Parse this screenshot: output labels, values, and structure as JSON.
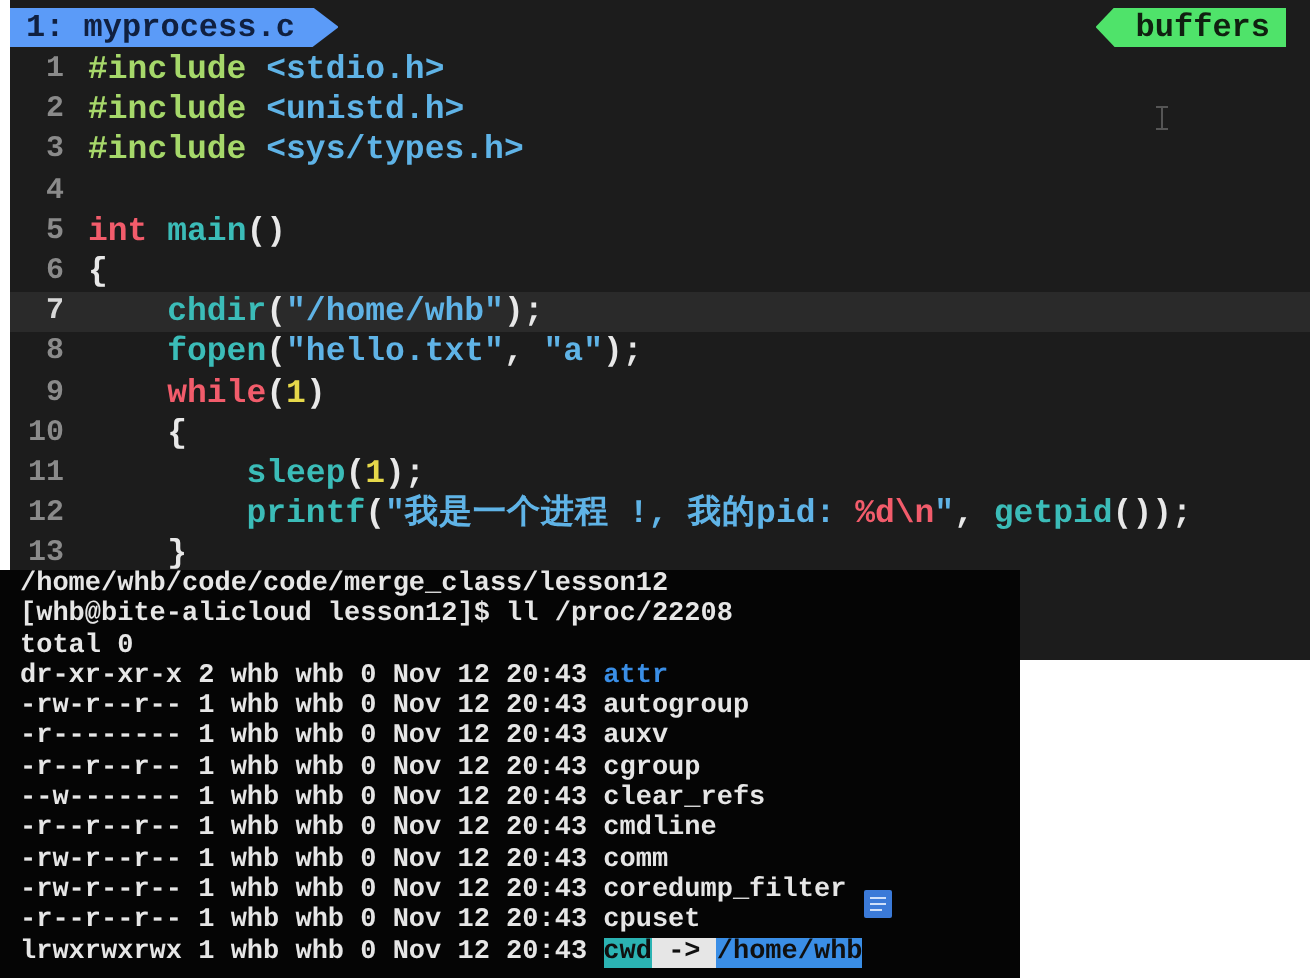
{
  "editor": {
    "tab_label": "1: myprocess.c",
    "buffers_label": "buffers",
    "lines": [
      {
        "number": "1",
        "current": false,
        "tokens": [
          {
            "kind": "pre",
            "text": "#include"
          },
          {
            "kind": "str",
            "text": " <stdio.h>"
          }
        ]
      },
      {
        "number": "2",
        "current": false,
        "tokens": [
          {
            "kind": "pre",
            "text": "#include"
          },
          {
            "kind": "str",
            "text": " <unistd.h>"
          }
        ]
      },
      {
        "number": "3",
        "current": false,
        "tokens": [
          {
            "kind": "pre",
            "text": "#include"
          },
          {
            "kind": "str",
            "text": " <sys/types.h>"
          }
        ]
      },
      {
        "number": "4",
        "current": false
      },
      {
        "number": "5",
        "current": false,
        "tokens": [
          {
            "kind": "kw",
            "text": "int"
          },
          {
            "kind": "fn",
            "text": " main"
          },
          {
            "kind": "plain",
            "text": "()"
          }
        ]
      },
      {
        "number": "6",
        "current": false,
        "tokens": [
          {
            "kind": "plain",
            "text": "{"
          }
        ]
      },
      {
        "number": "7",
        "current": true,
        "tokens": [
          {
            "kind": "fn",
            "text": "    chdir"
          },
          {
            "kind": "plain",
            "text": "("
          },
          {
            "kind": "str",
            "text": "\"/home/whb\""
          },
          {
            "kind": "plain",
            "text": ");"
          }
        ]
      },
      {
        "number": "8",
        "current": false,
        "tokens": [
          {
            "kind": "fn",
            "text": "    fopen"
          },
          {
            "kind": "plain",
            "text": "("
          },
          {
            "kind": "str",
            "text": "\"hello.txt\""
          },
          {
            "kind": "plain",
            "text": ","
          },
          {
            "kind": "str",
            "text": " \"a\""
          },
          {
            "kind": "plain",
            "text": ");"
          }
        ]
      },
      {
        "number": "9",
        "current": false,
        "tokens": [
          {
            "kind": "kw",
            "text": "    while"
          },
          {
            "kind": "plain",
            "text": "("
          },
          {
            "kind": "num",
            "text": "1"
          },
          {
            "kind": "plain",
            "text": ")"
          }
        ]
      },
      {
        "number": "10",
        "current": false,
        "tokens": [
          {
            "kind": "plain",
            "text": "    {"
          }
        ]
      },
      {
        "number": "11",
        "current": false,
        "tokens": [
          {
            "kind": "fn",
            "text": "        sleep"
          },
          {
            "kind": "plain",
            "text": "("
          },
          {
            "kind": "num",
            "text": "1"
          },
          {
            "kind": "plain",
            "text": ");"
          }
        ]
      },
      {
        "number": "12",
        "current": false,
        "tokens": [
          {
            "kind": "fn",
            "text": "        printf"
          },
          {
            "kind": "plain",
            "text": "("
          },
          {
            "kind": "str",
            "text": "\"我是一个进程 !, 我的pid: "
          },
          {
            "kind": "kw",
            "text": "%d\\n"
          },
          {
            "kind": "str",
            "text": "\""
          },
          {
            "kind": "plain",
            "text": ","
          },
          {
            "kind": "fn",
            "text": " getpid"
          },
          {
            "kind": "plain",
            "text": "());"
          }
        ]
      },
      {
        "number": "13",
        "current": false,
        "tokens": [
          {
            "kind": "plain",
            "text": "    }"
          }
        ]
      }
    ]
  },
  "terminal": {
    "lines": [
      {
        "segments": [
          {
            "kind": "plain",
            "text": "/home/whb/code/code/merge_class/lesson12"
          }
        ]
      },
      {
        "segments": [
          {
            "kind": "plain",
            "text": "[whb@bite-alicloud lesson12]$ ll /proc/22208"
          }
        ]
      },
      {
        "segments": [
          {
            "kind": "plain",
            "text": "total 0"
          }
        ]
      },
      {
        "segments": [
          {
            "kind": "plain",
            "text": "dr-xr-xr-x 2 whb whb 0 Nov 12 20:43 "
          },
          {
            "kind": "dir",
            "text": "attr"
          }
        ]
      },
      {
        "segments": [
          {
            "kind": "plain",
            "text": "-rw-r--r-- 1 whb whb 0 Nov 12 20:43 autogroup"
          }
        ]
      },
      {
        "segments": [
          {
            "kind": "plain",
            "text": "-r-------- 1 whb whb 0 Nov 12 20:43 auxv"
          }
        ]
      },
      {
        "segments": [
          {
            "kind": "plain",
            "text": "-r--r--r-- 1 whb whb 0 Nov 12 20:43 cgroup"
          }
        ]
      },
      {
        "segments": [
          {
            "kind": "plain",
            "text": "--w------- 1 whb whb 0 Nov 12 20:43 clear_refs"
          }
        ]
      },
      {
        "segments": [
          {
            "kind": "plain",
            "text": "-r--r--r-- 1 whb whb 0 Nov 12 20:43 cmdline"
          }
        ]
      },
      {
        "segments": [
          {
            "kind": "plain",
            "text": "-rw-r--r-- 1 whb whb 0 Nov 12 20:43 comm"
          }
        ]
      },
      {
        "segments": [
          {
            "kind": "plain",
            "text": "-rw-r--r-- 1 whb whb 0 Nov 12 20:43 coredump_filter"
          }
        ]
      },
      {
        "segments": [
          {
            "kind": "plain",
            "text": "-r--r--r-- 1 whb whb 0 Nov 12 20:43 cpuset"
          }
        ]
      },
      {
        "segments": [
          {
            "kind": "plain",
            "text": "lrwxrwxrwx 1 whb whb 0 Nov 12 20:43 "
          },
          {
            "kind": "link",
            "text": "cwd"
          },
          {
            "kind": "arrow",
            "text": " -> "
          },
          {
            "kind": "target",
            "text": "/home/whb"
          }
        ]
      }
    ]
  }
}
